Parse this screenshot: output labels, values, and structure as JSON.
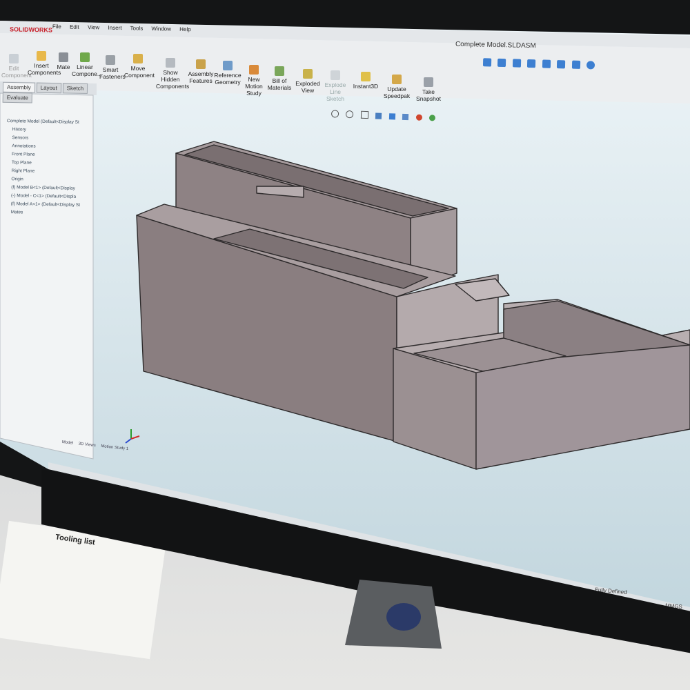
{
  "app": {
    "logo": "SOLIDWORKS",
    "document_title": "Complete Model.SLDASM",
    "menu": [
      "File",
      "Edit",
      "View",
      "Insert",
      "Tools",
      "Window",
      "Help"
    ]
  },
  "command_manager": {
    "buttons": [
      {
        "id": "edit-component",
        "label": "Edit Component",
        "icon": "edit-component-icon",
        "disabled": true
      },
      {
        "id": "insert-components",
        "label": "Insert Components",
        "icon": "insert-components-icon"
      },
      {
        "id": "mate",
        "label": "Mate",
        "icon": "mate-icon"
      },
      {
        "id": "linear-component",
        "label": "Linear Compone...",
        "icon": "linear-pattern-icon"
      },
      {
        "id": "smart-fasteners",
        "label": "Smart Fasteners",
        "icon": "smart-fasteners-icon"
      },
      {
        "id": "move-component",
        "label": "Move Component",
        "icon": "move-component-icon"
      },
      {
        "id": "show-hidden",
        "label": "Show Hidden Components",
        "icon": "show-hidden-icon"
      },
      {
        "id": "assembly-features",
        "label": "Assembly Features",
        "icon": "assembly-features-icon"
      },
      {
        "id": "reference-geometry",
        "label": "Reference Geometry",
        "icon": "reference-geometry-icon"
      },
      {
        "id": "new-motion-study",
        "label": "New Motion Study",
        "icon": "motion-study-icon"
      },
      {
        "id": "bill-of-materials",
        "label": "Bill of Materials",
        "icon": "bom-icon"
      },
      {
        "id": "exploded-view",
        "label": "Exploded View",
        "icon": "exploded-view-icon"
      },
      {
        "id": "explode-line-sketch",
        "label": "Explode Line Sketch",
        "icon": "explode-line-icon",
        "disabled": true
      },
      {
        "id": "instant3d",
        "label": "Instant3D",
        "icon": "instant3d-icon"
      },
      {
        "id": "update-speedpak",
        "label": "Update Speedpak",
        "icon": "speedpak-icon"
      },
      {
        "id": "take-snapshot",
        "label": "Take Snapshot",
        "icon": "snapshot-icon"
      }
    ],
    "tabs": [
      "Assembly",
      "Layout",
      "Sketch",
      "Evaluate"
    ]
  },
  "feature_tree": {
    "items": [
      "Complete Model (Default<Display St",
      "History",
      "Sensors",
      "Annotations",
      "Front Plane",
      "Top Plane",
      "Right Plane",
      "Origin",
      "(f) Model B<1> (Default<Display",
      "(-) Model - C<1> (Default<Displa",
      "(f) Model A<1> (Default<Display St",
      "Mates"
    ],
    "bottom_tabs": [
      "Model",
      "3D Views",
      "Motion Study 1"
    ]
  },
  "status": {
    "state": "Fully Defined",
    "units": "MMGS"
  },
  "desk": {
    "tooling_list_title": "Tooling list"
  },
  "colors": {
    "viewport_top": "#e9f1f5",
    "viewport_bottom": "#c9dbe3",
    "model_face": "#8f8284",
    "model_dark": "#6f6466",
    "model_light": "#b3a8aa",
    "toolbar_bg": "#e8eaec"
  }
}
